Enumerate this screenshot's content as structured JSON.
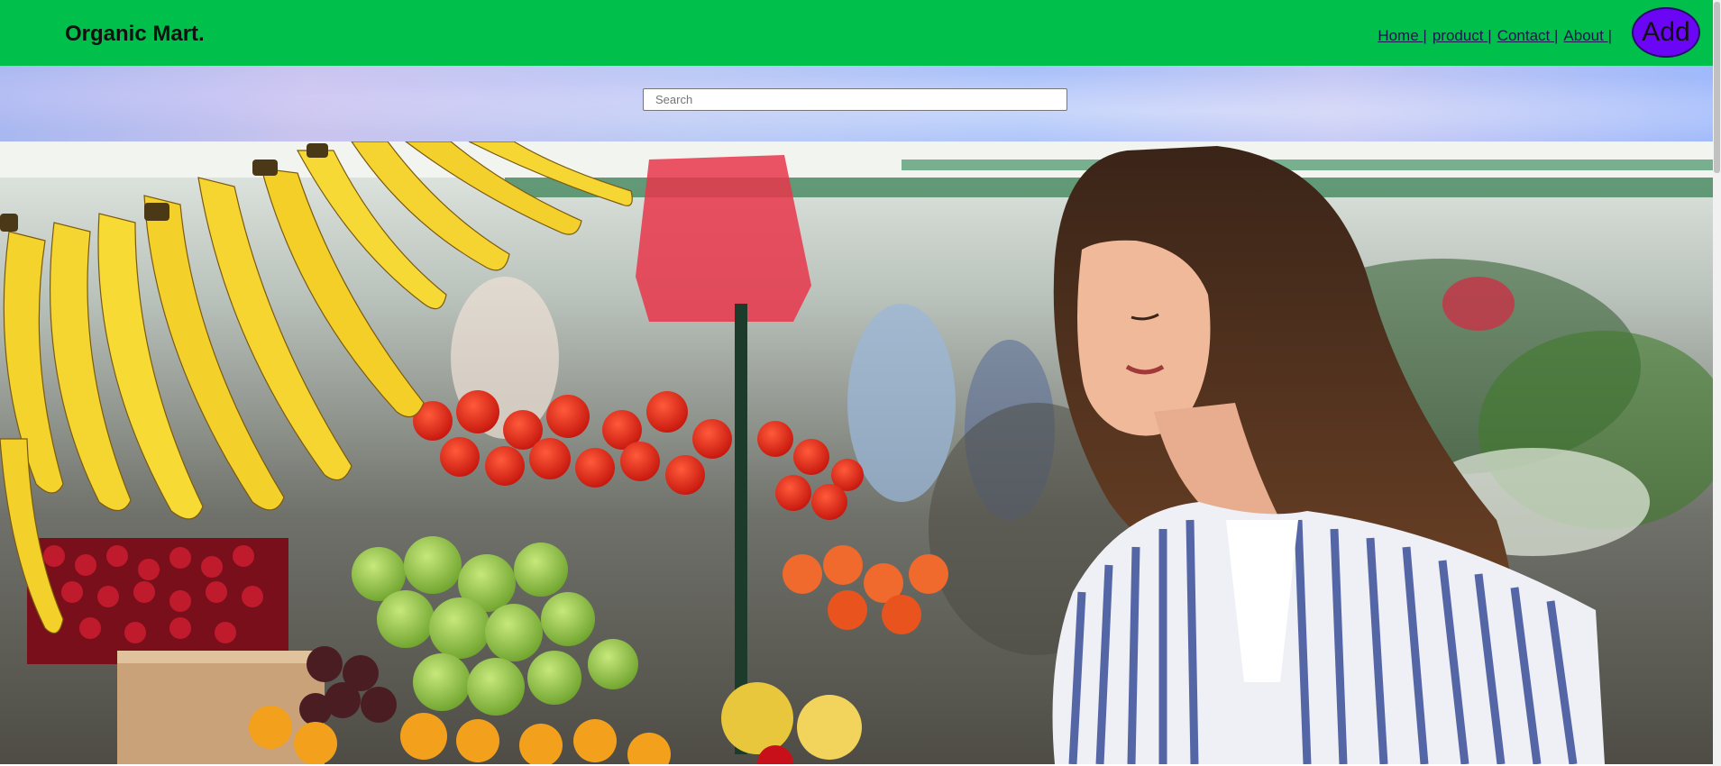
{
  "header": {
    "brand": "Organic Mart.",
    "nav": [
      {
        "label": "Home ",
        "sep": "|"
      },
      {
        "label": "product ",
        "sep": "|"
      },
      {
        "label": "Contact ",
        "sep": "|"
      },
      {
        "label": "About ",
        "sep": "|"
      }
    ],
    "add_button": "Add",
    "colors": {
      "bar": "#00c04b",
      "add_button": "#6a06f5"
    }
  },
  "search": {
    "placeholder": "Search",
    "value": ""
  },
  "hero": {
    "image": "market-hero-image",
    "description_icon": "photo-of-woman-shopping-produce"
  }
}
